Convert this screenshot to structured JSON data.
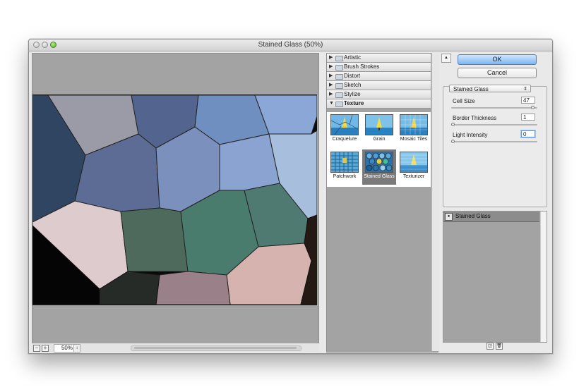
{
  "window": {
    "title": "Stained Glass (50%)"
  },
  "preview": {
    "zoom": "50%"
  },
  "gallery": {
    "categories": [
      {
        "label": "Artistic",
        "expanded": false
      },
      {
        "label": "Brush Strokes",
        "expanded": false
      },
      {
        "label": "Distort",
        "expanded": false
      },
      {
        "label": "Sketch",
        "expanded": false
      },
      {
        "label": "Stylize",
        "expanded": false
      },
      {
        "label": "Texture",
        "expanded": true
      }
    ],
    "texture_filters": [
      {
        "label": "Craquelure",
        "selected": false
      },
      {
        "label": "Grain",
        "selected": false
      },
      {
        "label": "Mosaic Tiles",
        "selected": false
      },
      {
        "label": "Patchwork",
        "selected": false
      },
      {
        "label": "Stained Glass",
        "selected": true
      },
      {
        "label": "Texturizer",
        "selected": false
      }
    ]
  },
  "buttons": {
    "ok": "OK",
    "cancel": "Cancel"
  },
  "settings": {
    "filter_select": "Stained Glass",
    "params": [
      {
        "label": "Cell Size",
        "value": "47",
        "slider": 0.96
      },
      {
        "label": "Border Thickness",
        "value": "1",
        "slider": 0.0
      },
      {
        "label": "Light Intensity",
        "value": "0",
        "slider": 0.0
      }
    ]
  },
  "layers": {
    "items": [
      {
        "name": "Stained Glass"
      }
    ]
  },
  "colors": {
    "accent": "#7fb6f0",
    "panel": "#a3a3a3"
  }
}
